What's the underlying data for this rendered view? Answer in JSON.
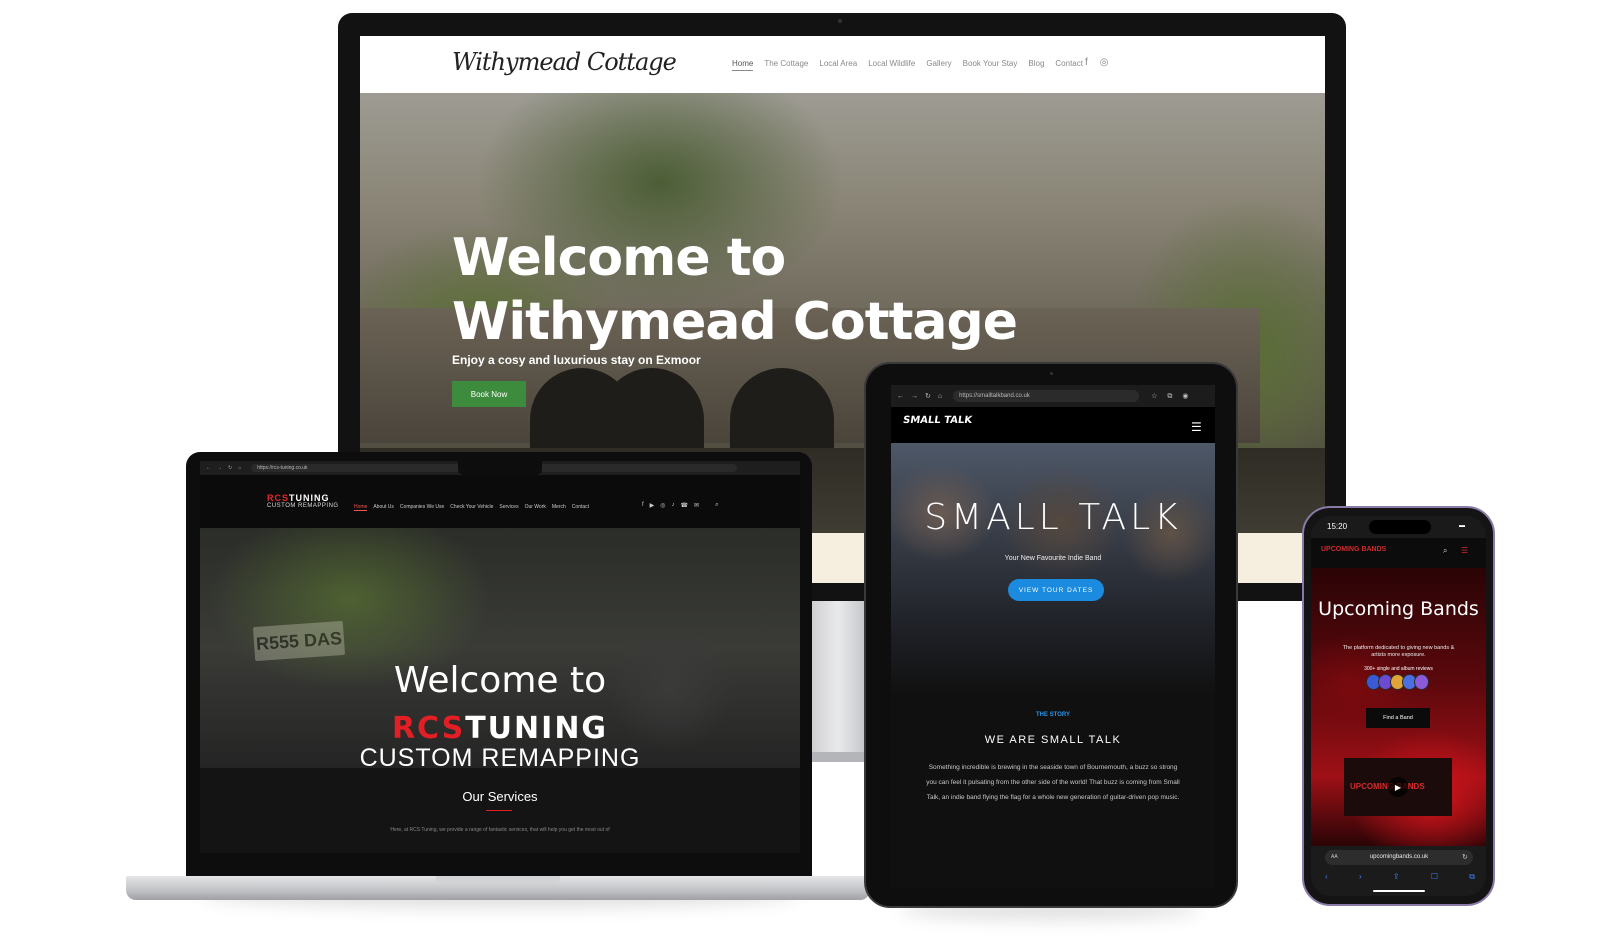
{
  "desktop": {
    "logo": "Withymead Cottage",
    "nav": [
      "Home",
      "The Cottage",
      "Local Area",
      "Local Wildlife",
      "Gallery",
      "Book Your Stay",
      "Blog",
      "Contact"
    ],
    "social_icons": [
      "facebook-icon",
      "instagram-icon"
    ],
    "hero_title": "Welcome to Withymead Cottage",
    "hero_subtitle": "Enjoy a cosy and luxurious stay on Exmoor",
    "hero_button": "Book Now",
    "accent_color": "#3d8b3c"
  },
  "laptop": {
    "url": "https://rcs-tuning.co.uk",
    "logo_red": "RCS",
    "logo_white": "TUNING",
    "logo_sub": "CUSTOM REMAPPING",
    "nav": [
      "Home",
      "About Us",
      "Companies We Use",
      "Check Your Vehicle",
      "Services",
      "Our Work",
      "Merch",
      "Contact"
    ],
    "social_icons": [
      "facebook-icon",
      "youtube-icon",
      "instagram-icon",
      "tiktok-icon",
      "phone-icon",
      "email-icon",
      "search-icon"
    ],
    "plate": "R555 DAS",
    "hero_welcome": "Welcome to",
    "hero_brand_red": "RCS",
    "hero_brand_white": "TUNING",
    "hero_remap": "CUSTOM REMAPPING",
    "services_title": "Our Services",
    "services_text": "Here, at RCS Tuning, we provide a range of fantastic services, that will help you get the most out of",
    "accent_color": "#e31e24"
  },
  "tablet": {
    "url": "https://smalltalkband.co.uk",
    "logo": "SMALL TALK",
    "hero_title": "SMALL TALK",
    "hero_subtitle": "Your New Favourite Indie Band",
    "hero_button": "VIEW TOUR DATES",
    "story_tag": "THE STORY",
    "story_heading": "WE ARE SMALL TALK",
    "story_text": "Something incredible is brewing in the seaside town of Bournemouth, a buzz so strong you can feel it pulsating from the other side of the world! That buzz is coming from Small Talk, an indie band flying the flag for a whole new generation of guitar-driven pop music.",
    "accent_color": "#1a8bde"
  },
  "phone": {
    "time": "15:20",
    "logo": "UPCOMING BANDS",
    "hero_title": "Upcoming Bands",
    "hero_subtitle": "The platform dedicated to giving new bands & artists more exposure.",
    "reviews_count": "300+ single and album reviews",
    "hero_button": "Find a Band",
    "video_label": "UPCOMING BANDS",
    "url_prefix": "AA",
    "url": "upcomingbands.co.uk",
    "accent_color": "#d42a2a"
  }
}
